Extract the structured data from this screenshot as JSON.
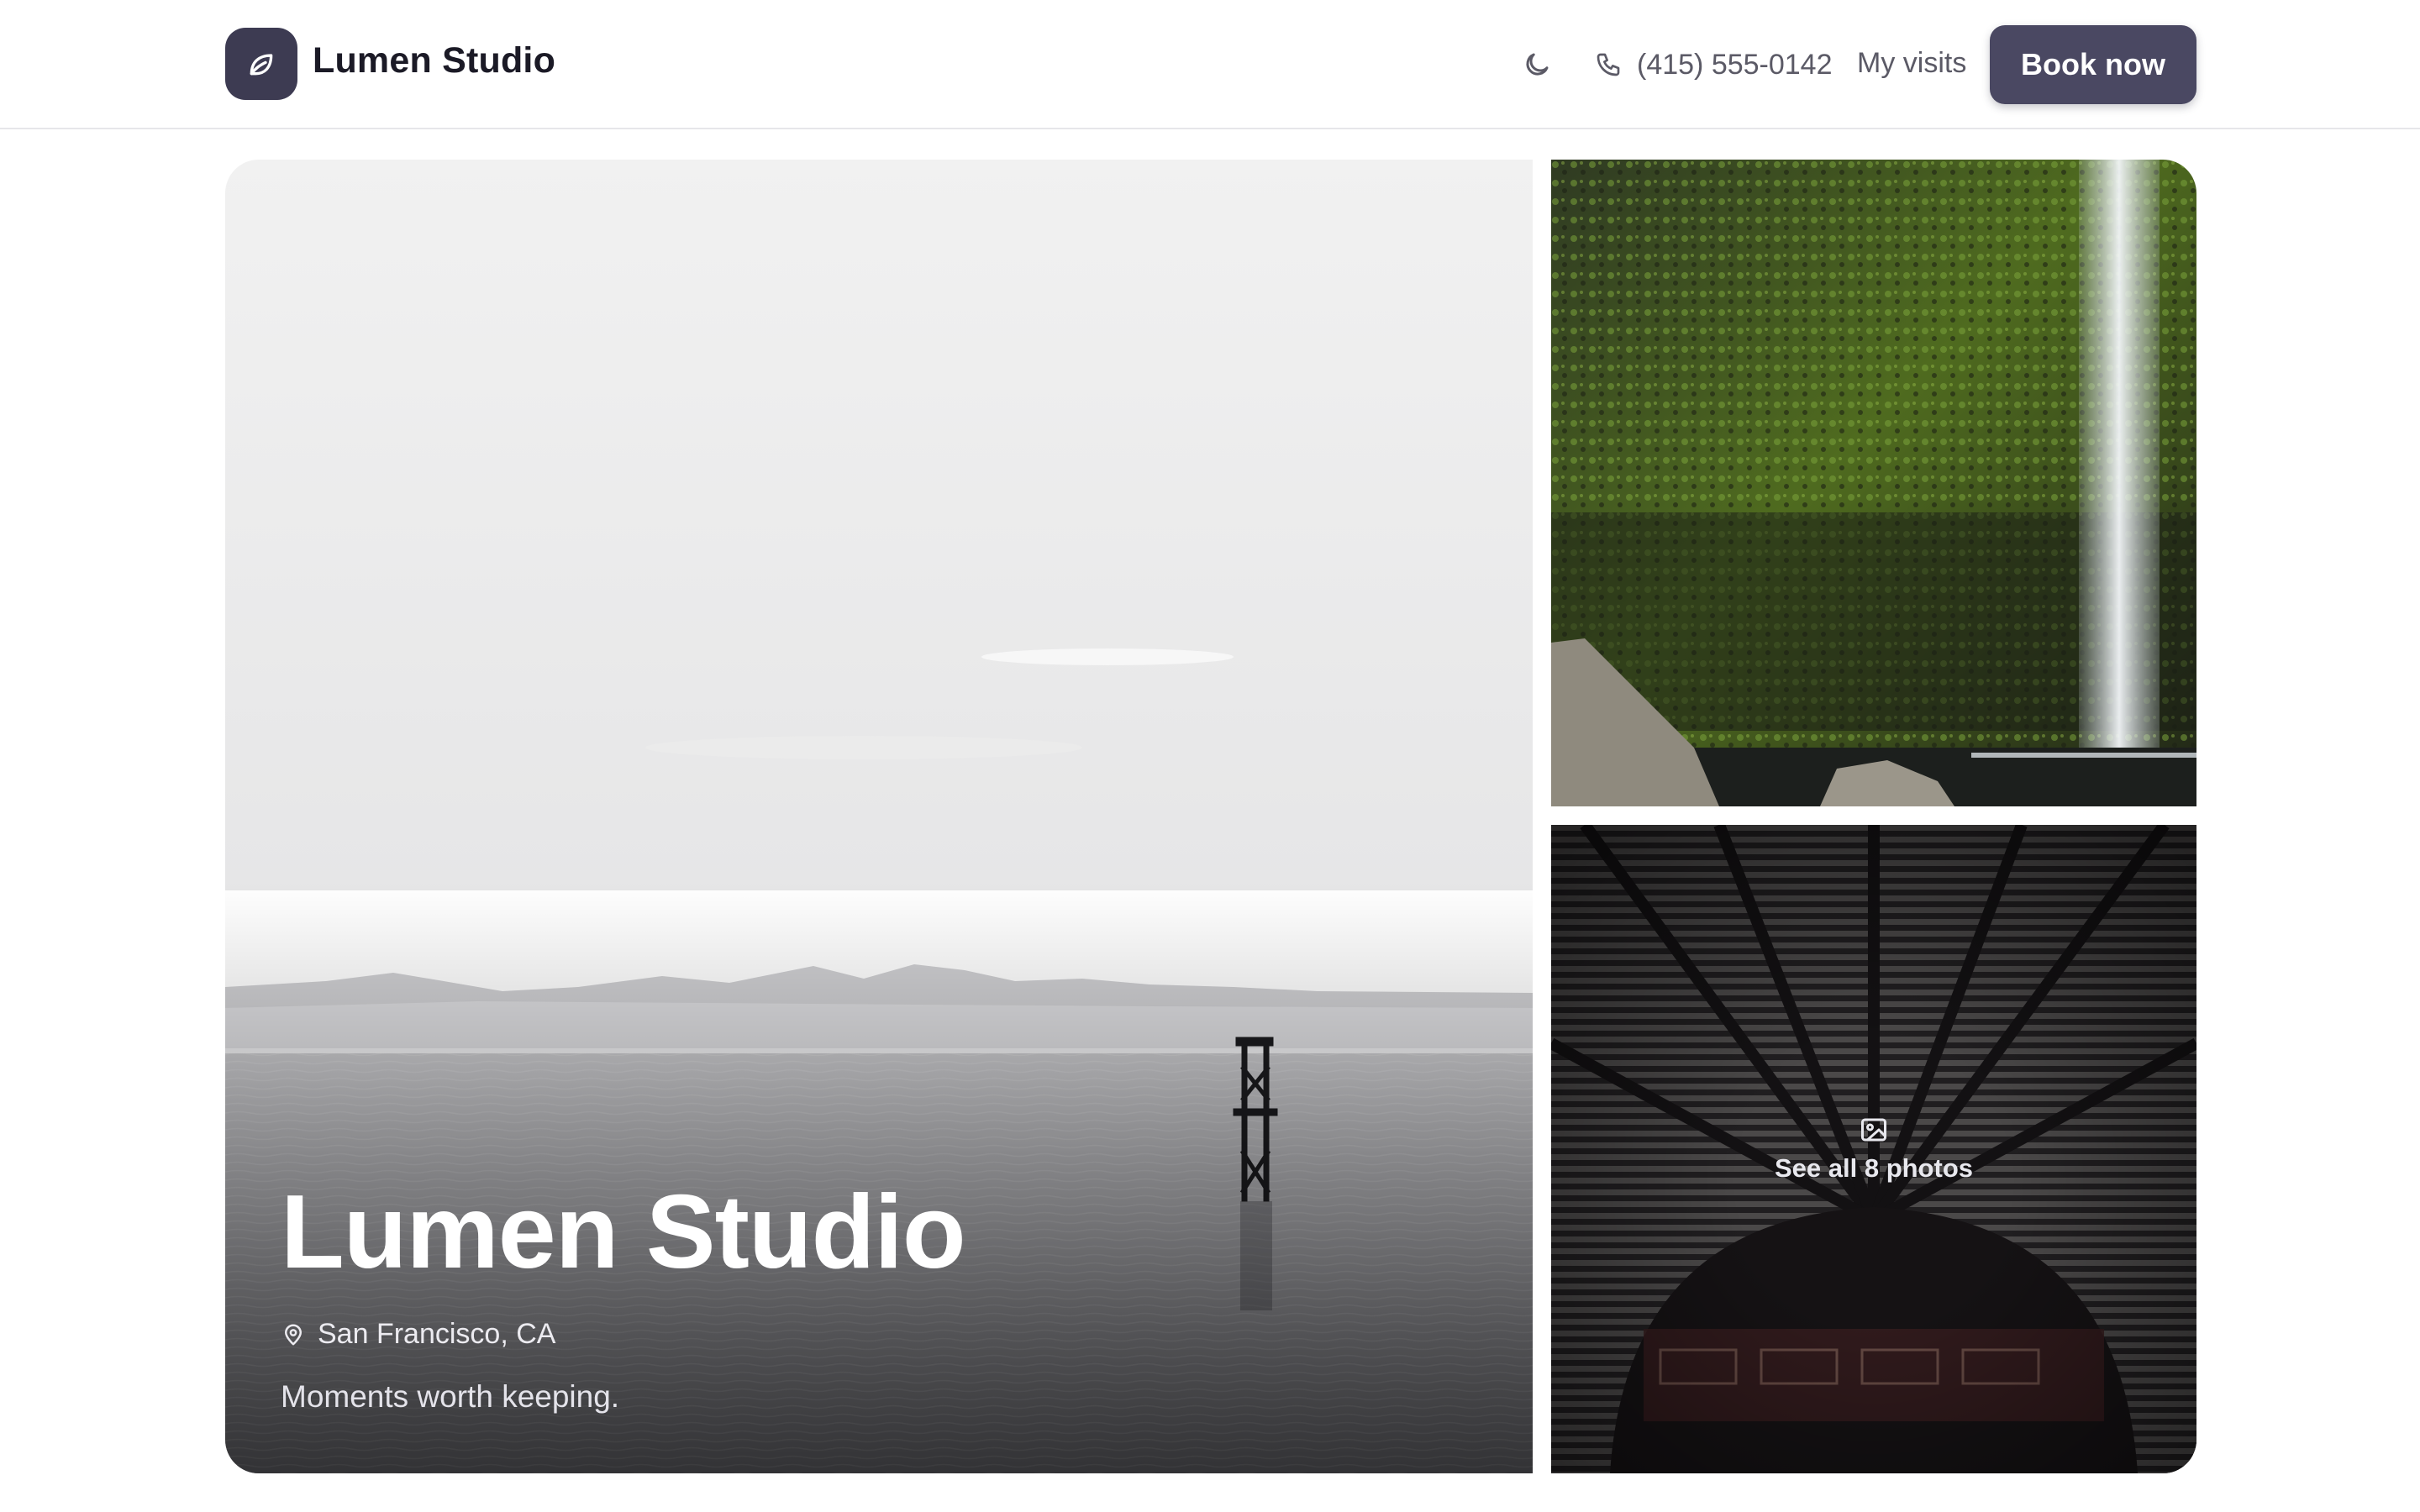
{
  "header": {
    "brand": "Lumen Studio",
    "phone": "(415) 555-0142",
    "my_visits": "My visits",
    "book_now": "Book now"
  },
  "hero": {
    "title": "Lumen Studio",
    "location": "San Francisco, CA",
    "tagline": "Moments worth keeping."
  },
  "gallery": {
    "see_all": "See all 8 photos"
  },
  "icons": {
    "logo": "leaf-icon",
    "theme": "moon-icon",
    "phone": "phone-icon",
    "location": "map-pin-icon",
    "photos": "image-icon"
  },
  "colors": {
    "accent": "#4a4862",
    "logo_bg": "#3d3b52",
    "text": "#1b1a26",
    "muted": "#5b5a66"
  }
}
